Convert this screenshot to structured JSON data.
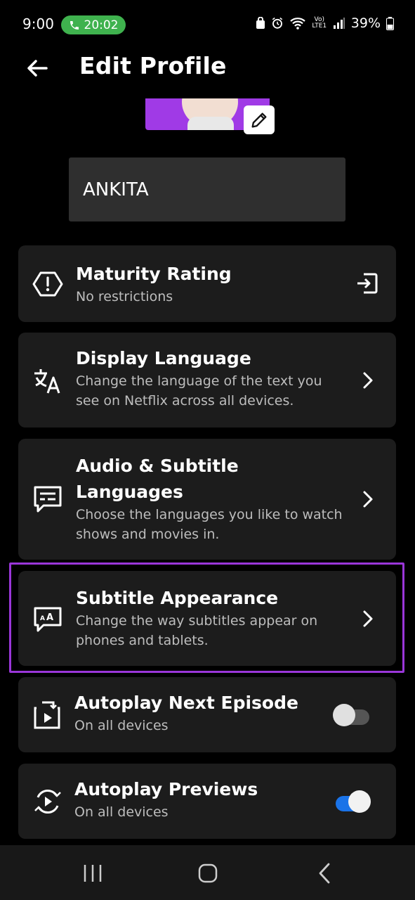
{
  "status_bar": {
    "time": "9:00",
    "call_time": "20:02",
    "battery": "39%",
    "network": "Vo) LTE1"
  },
  "header": {
    "title": "Edit Profile"
  },
  "profile": {
    "name_value": "ANKITA"
  },
  "settings": [
    {
      "title": "Maturity Rating",
      "subtitle": "No restrictions",
      "icon": "warning-hexagon-icon",
      "action": "open-external-icon"
    },
    {
      "title": "Display Language",
      "subtitle": "Change the language of the text you see on Netflix across all devices.",
      "icon": "translate-icon",
      "action": "chevron-right-icon"
    },
    {
      "title": "Audio & Subtitle Languages",
      "subtitle": "Choose the languages you like to watch shows and movies in.",
      "icon": "subtitles-icon",
      "action": "chevron-right-icon"
    },
    {
      "title": "Subtitle Appearance",
      "subtitle": "Change the way subtitles appear on phones and tablets.",
      "icon": "subtitle-appearance-icon",
      "action": "chevron-right-icon",
      "highlighted": true
    },
    {
      "title": "Autoplay Next Episode",
      "subtitle": "On all devices",
      "icon": "autoplay-next-icon",
      "toggle_on": false
    },
    {
      "title": "Autoplay Previews",
      "subtitle": "On all devices",
      "icon": "autoplay-previews-icon",
      "toggle_on": true
    }
  ],
  "colors": {
    "highlight": "#9a36d9",
    "toggle_on": "#1a73e8",
    "call_pill": "#3fb24e",
    "avatar_bg": "#a03ae6"
  },
  "nav": [
    "recent-apps-icon",
    "home-icon",
    "back-icon"
  ]
}
